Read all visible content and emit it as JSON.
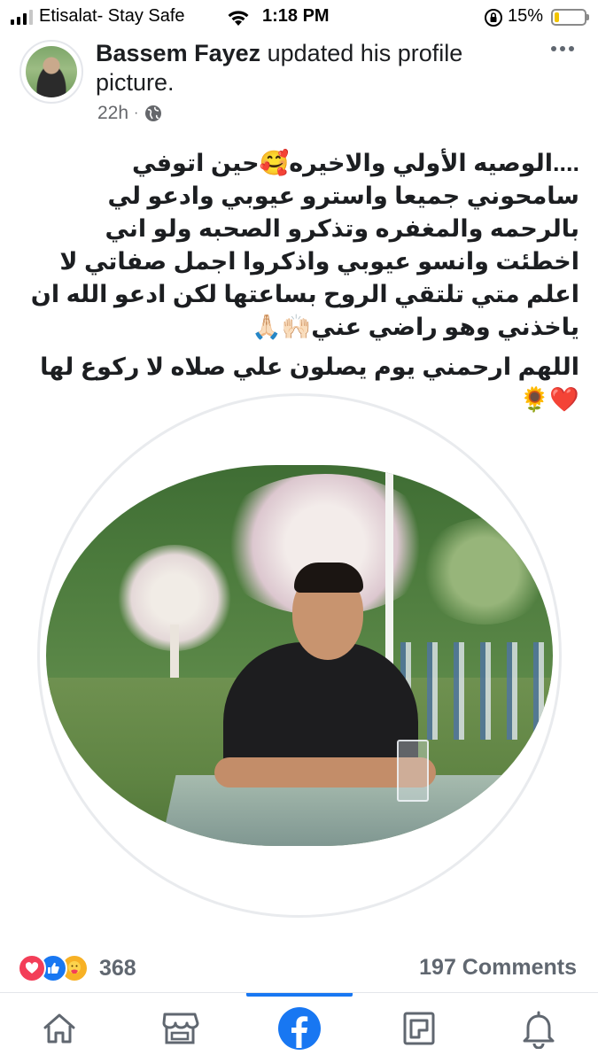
{
  "status_bar": {
    "carrier": "Etisalat- Stay Safe",
    "time": "1:18 PM",
    "battery_percent": "15%",
    "battery_level": 0.15,
    "signal_bars_active": 3,
    "signal_bars_total": 4
  },
  "post": {
    "author_name": "Bassem Fayez",
    "action_text": " updated his profile picture.",
    "time_ago": "22h",
    "separator": "·",
    "privacy_icon": "globe-icon",
    "more_icon": "more-horizontal-icon",
    "caption_paragraph_1": "....الوصيه الأولي والاخيره🥰حين اتوفي سامحوني جميعا واسترو عيوبي وادعو لي بالرحمه والمغفره وتذكرو الصحبه ولو اني اخطئت وانسو عيوبي واذكروا اجمل صفاتي لا اعلم متي تلتقي الروح بساعتها لكن ادعو الله ان ياخذني وهو راضي عني🙌🏻🙏🏻",
    "caption_paragraph_2": "اللهم ارحمني يوم يصلون علي صلاه لا ركوع لها❤️🌻"
  },
  "engagement": {
    "reaction_icons": [
      "love-reaction-icon",
      "like-reaction-icon",
      "care-reaction-icon"
    ],
    "reaction_count": "368",
    "comments_label": "197 Comments"
  },
  "bottom_nav": {
    "items": [
      {
        "name": "home",
        "icon": "home-icon"
      },
      {
        "name": "marketplace",
        "icon": "marketplace-icon"
      },
      {
        "name": "facebook",
        "icon": "facebook-logo-icon",
        "active": true
      },
      {
        "name": "pages",
        "icon": "pages-icon"
      },
      {
        "name": "notifications",
        "icon": "bell-icon"
      }
    ]
  },
  "colors": {
    "accent": "#1877f2",
    "text": "#1c1e21",
    "muted": "#65676b",
    "love": "#f33e58",
    "care": "#f7b125"
  }
}
